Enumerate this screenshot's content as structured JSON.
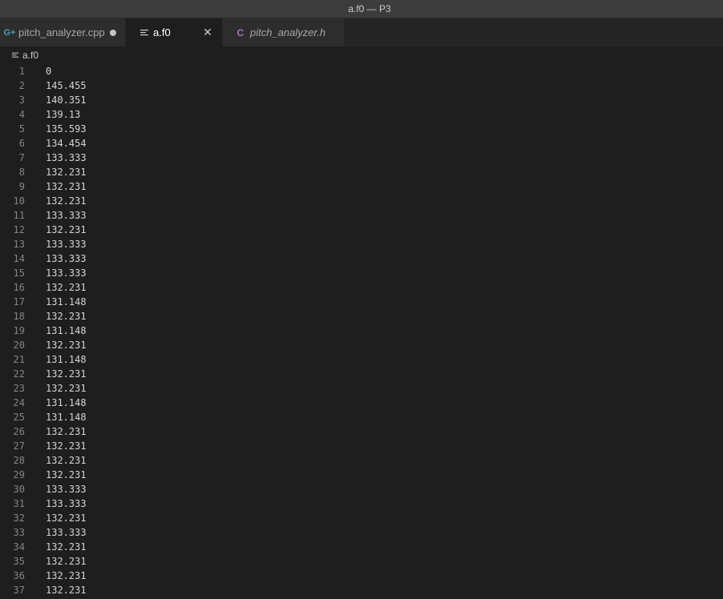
{
  "window": {
    "title": "a.f0 — P3"
  },
  "tabs": [
    {
      "label": "pitch_analyzer.cpp",
      "icon": "cpp-file-icon",
      "state": "modified"
    },
    {
      "label": "a.f0",
      "icon": "text-file-icon",
      "state": "active"
    },
    {
      "label": "pitch_analyzer.h",
      "icon": "c-header-file-icon",
      "state": "inactive"
    }
  ],
  "breadcrumb": {
    "file": "a.f0"
  },
  "editor": {
    "lines": [
      "0",
      "145.455",
      "140.351",
      "139.13",
      "135.593",
      "134.454",
      "133.333",
      "132.231",
      "132.231",
      "132.231",
      "133.333",
      "132.231",
      "133.333",
      "133.333",
      "133.333",
      "132.231",
      "131.148",
      "132.231",
      "131.148",
      "132.231",
      "131.148",
      "132.231",
      "132.231",
      "131.148",
      "131.148",
      "132.231",
      "132.231",
      "132.231",
      "132.231",
      "133.333",
      "133.333",
      "132.231",
      "133.333",
      "132.231",
      "132.231",
      "132.231",
      "132.231"
    ]
  },
  "colors": {
    "editor_bg": "#1e1e1e",
    "tabbar_bg": "#252526",
    "titlebar_bg": "#3c3c3c",
    "cpp_icon": "#519aba",
    "c_icon": "#a074c4"
  }
}
